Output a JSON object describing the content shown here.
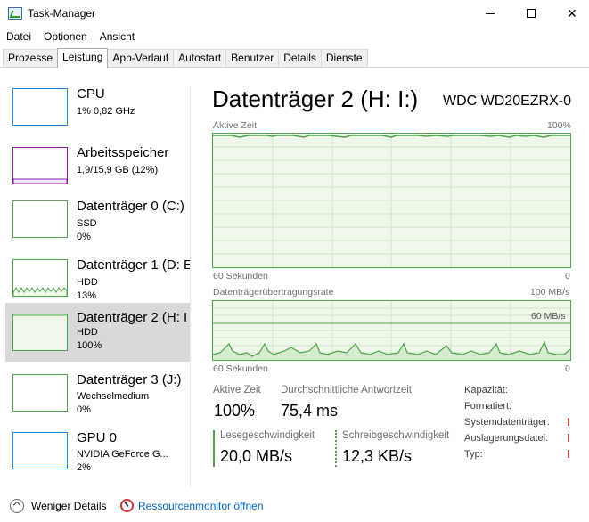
{
  "window": {
    "title": "Task-Manager",
    "icon": "task-manager-icon"
  },
  "menu": [
    {
      "label": "Datei"
    },
    {
      "label": "Optionen"
    },
    {
      "label": "Ansicht"
    }
  ],
  "tabs": [
    {
      "label": "Prozesse",
      "active": false
    },
    {
      "label": "Leistung",
      "active": true
    },
    {
      "label": "App-Verlauf",
      "active": false
    },
    {
      "label": "Autostart",
      "active": false
    },
    {
      "label": "Benutzer",
      "active": false
    },
    {
      "label": "Details",
      "active": false
    },
    {
      "label": "Dienste",
      "active": false
    }
  ],
  "sidebar": {
    "items": [
      {
        "title": "CPU",
        "line1": "1% 0,82 GHz",
        "line2": "",
        "color": "#1f8fd6",
        "selected": false
      },
      {
        "title": "Arbeitsspeicher",
        "line1": "1,9/15,9 GB (12%)",
        "line2": "",
        "color": "#8b1fa8",
        "selected": false
      },
      {
        "title": "Datenträger 0 (C:)",
        "line1": "SSD",
        "line2": "0%",
        "color": "#4da44b",
        "selected": false
      },
      {
        "title": "Datenträger 1 (D: E",
        "line1": "HDD",
        "line2": "13%",
        "color": "#4da44b",
        "selected": false
      },
      {
        "title": "Datenträger 2 (H: I",
        "line1": "HDD",
        "line2": "100%",
        "color": "#4da44b",
        "selected": true
      },
      {
        "title": "Datenträger 3 (J:)",
        "line1": "Wechselmedium",
        "line2": "0%",
        "color": "#4da44b",
        "selected": false
      },
      {
        "title": "GPU 0",
        "line1": "NVIDIA GeForce G...",
        "line2": "2%",
        "color": "#1f8fd6",
        "selected": false
      }
    ]
  },
  "main": {
    "title": "Datenträger 2 (H: I:)",
    "model": "WDC WD20EZRX-0...",
    "graph1": {
      "label": "Aktive Zeit",
      "max_label": "100%",
      "time_label": "60 Sekunden",
      "min_label": "0",
      "active_time_percent": 100
    },
    "graph2": {
      "label": "Datenträgerübertragungsrate",
      "max_label": "100 MB/s",
      "mid_label": "60 MB/s",
      "time_label": "60 Sekunden",
      "min_label": "0"
    },
    "stats": {
      "active_label": "Aktive Zeit",
      "active_value": "100%",
      "response_label": "Durchschnittliche Antwortzeit",
      "response_value": "75,4 ms",
      "read_label": "Lesegeschwindigkeit",
      "read_value": "20,0 MB/s",
      "write_label": "Schreibgeschwindigkeit",
      "write_value": "12,3 KB/s"
    },
    "properties": [
      {
        "label": "Kapazität:"
      },
      {
        "label": "Formatiert:"
      },
      {
        "label": "Systemdatenträger:"
      },
      {
        "label": "Auslagerungsdatei:"
      },
      {
        "label": "Typ:"
      }
    ]
  },
  "footer": {
    "less_details": "Weniger Details",
    "resource_monitor": "Ressourcenmonitor öffnen"
  },
  "colors": {
    "disk_green": "#4da44b",
    "graph_fill": "#eff7eb",
    "cpu_blue": "#1f8fd6",
    "memory_purple": "#8b1fa8",
    "selected_bg": "#d9d9d9",
    "link_blue": "#0066cc"
  }
}
